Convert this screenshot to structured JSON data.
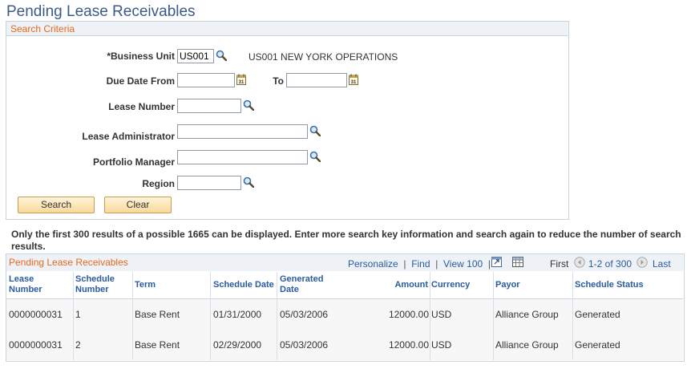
{
  "page": {
    "title": "Pending Lease Receivables"
  },
  "search_criteria": {
    "title": "Search Criteria",
    "business_unit": {
      "label": "*Business Unit",
      "value": "US001",
      "description": "US001 NEW YORK OPERATIONS"
    },
    "due_date_from": {
      "label": "Due Date From",
      "value": ""
    },
    "due_date_to": {
      "label": "To",
      "value": ""
    },
    "lease_number": {
      "label": "Lease Number",
      "value": ""
    },
    "lease_administrator": {
      "label": "Lease Administrator",
      "value": ""
    },
    "portfolio_manager": {
      "label": "Portfolio Manager",
      "value": ""
    },
    "region": {
      "label": "Region",
      "value": ""
    },
    "search_label": "Search",
    "clear_label": "Clear"
  },
  "message": "Only the first 300 results of a possible 1665 can be displayed. Enter more search key information and search again to reduce the number of search results.",
  "grid": {
    "title": "Pending Lease Receivables",
    "personalize": "Personalize",
    "find": "Find",
    "view100": "View 100",
    "first": "First",
    "range": "1-2 of 300",
    "last": "Last",
    "columns": {
      "lease_number": [
        "Lease",
        "Number"
      ],
      "schedule_number": [
        "Schedule",
        "Number"
      ],
      "term": "Term",
      "schedule_date": "Schedule Date",
      "generated_date": [
        "Generated",
        "Date"
      ],
      "amount": "Amount",
      "currency": "Currency",
      "payor": "Payor",
      "schedule_status": "Schedule Status"
    },
    "rows": [
      {
        "lease_number": "0000000031",
        "schedule_number": "1",
        "term": "Base Rent",
        "schedule_date": "01/31/2000",
        "generated_date": "05/03/2006",
        "amount": "12000.00",
        "currency": "USD",
        "payor": "Alliance Group",
        "schedule_status": "Generated"
      },
      {
        "lease_number": "0000000031",
        "schedule_number": "2",
        "term": "Base Rent",
        "schedule_date": "02/29/2000",
        "generated_date": "05/03/2006",
        "amount": "12000.00",
        "currency": "USD",
        "payor": "Alliance Group",
        "schedule_status": "Generated"
      }
    ]
  }
}
